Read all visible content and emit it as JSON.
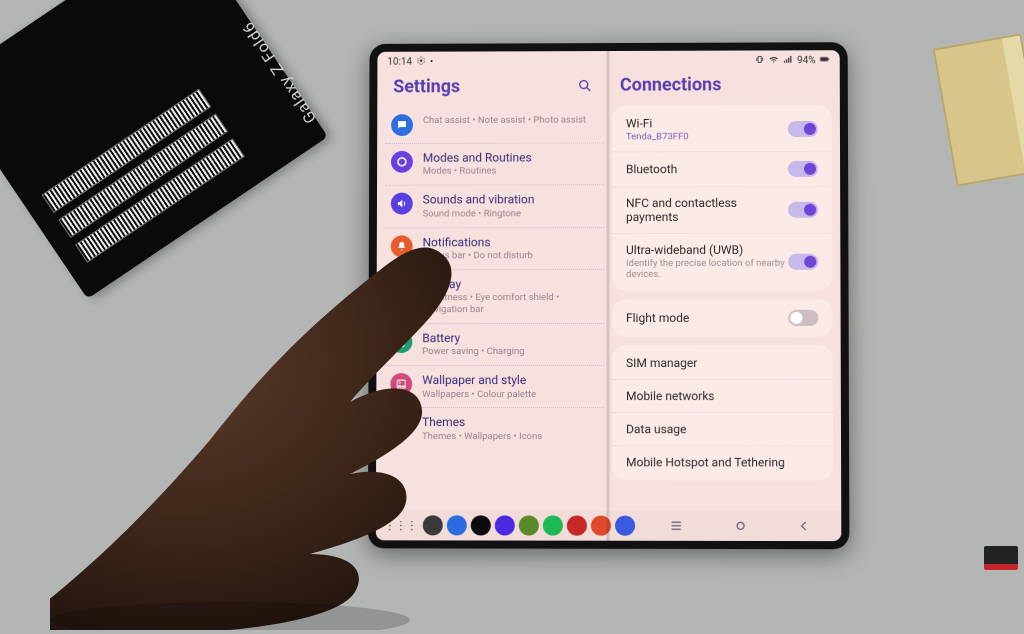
{
  "box_brand": "Galaxy Z Fold6",
  "status": {
    "time": "10:14",
    "battery_pct": "94%"
  },
  "left": {
    "title": "Settings",
    "items": [
      {
        "icon": "chat",
        "color": "#2f6de0",
        "title": "",
        "sub": "Chat assist  •  Note assist  •  Photo assist"
      },
      {
        "icon": "routine",
        "color": "#6d3fe0",
        "title": "Modes and Routines",
        "sub": "Modes  •  Routines"
      },
      {
        "icon": "sound",
        "color": "#5a3fe0",
        "title": "Sounds and vibration",
        "sub": "Sound mode  •  Ringtone"
      },
      {
        "icon": "bell",
        "color": "#e85b2f",
        "title": "Notifications",
        "sub": "Status bar  •  Do not disturb"
      },
      {
        "icon": "display",
        "color": "#2fa862",
        "title": "Display",
        "sub": "Brightness  •  Eye comfort shield  •  Navigation bar"
      },
      {
        "icon": "battery",
        "color": "#1e9c70",
        "title": "Battery",
        "sub": "Power saving  •  Charging"
      },
      {
        "icon": "wall",
        "color": "#d14a7a",
        "title": "Wallpaper and style",
        "sub": "Wallpapers  •  Colour palette"
      },
      {
        "icon": "theme",
        "color": "#c44a6e",
        "title": "Themes",
        "sub": "Themes  •  Wallpapers  •  Icons"
      }
    ]
  },
  "right": {
    "title": "Connections",
    "card1": [
      {
        "label": "Wi-Fi",
        "sub": "Tenda_B73FF0",
        "sub_style": "purple",
        "toggle": true
      },
      {
        "label": "Bluetooth",
        "toggle": true
      },
      {
        "label": "NFC and contactless payments",
        "toggle": true
      },
      {
        "label": "Ultra-wideband (UWB)",
        "sub": "Identify the precise location of nearby devices.",
        "sub_style": "grey",
        "toggle": true
      }
    ],
    "card2": [
      {
        "label": "Flight mode",
        "toggle": false
      }
    ],
    "card3": [
      {
        "label": "SIM manager"
      },
      {
        "label": "Mobile networks"
      },
      {
        "label": "Data usage"
      },
      {
        "label": "Mobile Hotspot and Tethering"
      }
    ]
  },
  "taskbar_colors": [
    "#3a3a3a",
    "#2a6de0",
    "#0a0a0a",
    "#4a2ae0",
    "#5a8a2a",
    "#1db954",
    "#c62828",
    "#e04a2a",
    "#3a5ae0"
  ]
}
